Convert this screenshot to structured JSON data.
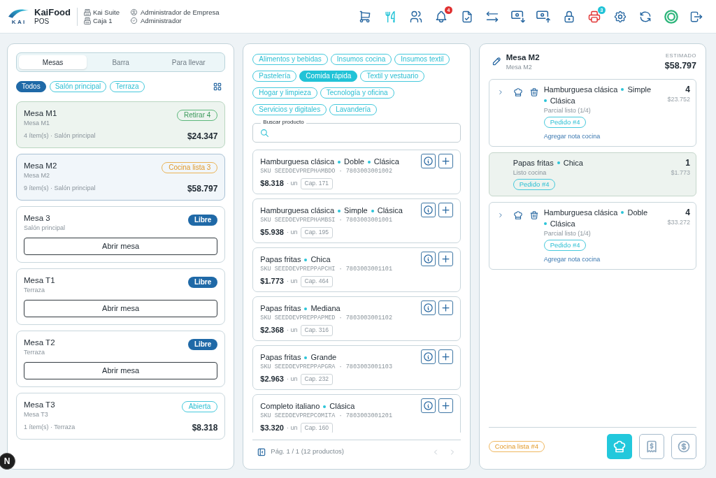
{
  "header": {
    "logo_text": "KAI",
    "app_name": "KaiFood",
    "app_subtitle": "POS",
    "suite": "Kai Suite",
    "register": "Caja 1",
    "company_role": "Administrador de Empresa",
    "user_role": "Administrador",
    "actions": [
      {
        "kind": "cart",
        "color": "#2767a1"
      },
      {
        "kind": "menu",
        "color": "#22c3d7"
      },
      {
        "kind": "customers",
        "color": "#2767a1"
      },
      {
        "kind": "notifications",
        "color": "#2767a1",
        "badge": {
          "text": "4",
          "color": "#e03131"
        }
      },
      {
        "kind": "documents",
        "color": "#2767a1"
      },
      {
        "kind": "transfer",
        "color": "#2767a1"
      },
      {
        "kind": "cash_in",
        "color": "#2767a1"
      },
      {
        "kind": "cash_out",
        "color": "#2767a1"
      },
      {
        "kind": "lock",
        "color": "#2767a1"
      },
      {
        "kind": "printer",
        "color": "#e03131",
        "badge": {
          "text": "3",
          "color": "#22c3d7"
        }
      },
      {
        "kind": "settings",
        "color": "#2767a1"
      },
      {
        "kind": "sync",
        "color": "#2767a1"
      },
      {
        "kind": "status",
        "color": "#2fb67c"
      },
      {
        "kind": "logout",
        "color": "#2767a1"
      }
    ]
  },
  "tables_panel": {
    "tabs": [
      {
        "label": "Mesas",
        "selected": true
      },
      {
        "label": "Barra",
        "selected": false
      },
      {
        "label": "Para llevar",
        "selected": false
      }
    ],
    "zones": [
      {
        "label": "Todos",
        "selected": true
      },
      {
        "label": "Salón principal",
        "selected": false
      },
      {
        "label": "Terraza",
        "selected": false
      }
    ],
    "tables": [
      {
        "kind": "occupied",
        "name": "Mesa M1",
        "subtitle": "Mesa M1",
        "selected": false,
        "status": {
          "kind": "pickup",
          "label": "Retirar 4"
        },
        "summary": "4 ítem(s) · Salón principal",
        "total": "$24.347"
      },
      {
        "kind": "occupied",
        "name": "Mesa M2",
        "subtitle": "Mesa M2",
        "selected": true,
        "status": {
          "kind": "kitchen",
          "label": "Cocina lista 3"
        },
        "summary": "9 ítem(s) · Salón principal",
        "total": "$58.797"
      },
      {
        "kind": "free",
        "name": "Mesa 3",
        "subtitle": "Salón principal",
        "selected": false,
        "status": {
          "kind": "free",
          "label": "Libre"
        },
        "action": "Abrir mesa"
      },
      {
        "kind": "free",
        "name": "Mesa T1",
        "subtitle": "Terraza",
        "selected": false,
        "status": {
          "kind": "free",
          "label": "Libre"
        },
        "action": "Abrir mesa"
      },
      {
        "kind": "free",
        "name": "Mesa T2",
        "subtitle": "Terraza",
        "selected": false,
        "status": {
          "kind": "free",
          "label": "Libre"
        },
        "action": "Abrir mesa"
      },
      {
        "kind": "occupied",
        "name": "Mesa T3",
        "subtitle": "Mesa T3",
        "selected": false,
        "status": {
          "kind": "open",
          "label": "Abierta"
        },
        "summary": "1 ítem(s) · Terraza",
        "total": "$8.318"
      }
    ]
  },
  "products_panel": {
    "categories": [
      {
        "label": "Alimentos y bebidas",
        "selected": false
      },
      {
        "label": "Insumos cocina",
        "selected": false
      },
      {
        "label": "Insumos textil",
        "selected": false
      },
      {
        "label": "Pastelería",
        "selected": false
      },
      {
        "label": "Comida rápida",
        "selected": true
      },
      {
        "label": "Textil y vestuario",
        "selected": false
      },
      {
        "label": "Hogar y limpieza",
        "selected": false
      },
      {
        "label": "Tecnología y oficina",
        "selected": false
      },
      {
        "label": "Servicios y digitales",
        "selected": false
      },
      {
        "label": "Lavandería",
        "selected": false
      }
    ],
    "search": {
      "label": "Buscar producto"
    },
    "products": [
      {
        "name_parts": [
          "Hamburguesa clásica",
          "Doble",
          "Clásica"
        ],
        "sku": "SKU SEEDDEVPREPHAMBDO · 7803003001002",
        "price": "$8.318",
        "unit": "· un",
        "stock": "Cap. 171"
      },
      {
        "name_parts": [
          "Hamburguesa clásica",
          "Simple",
          "Clásica"
        ],
        "sku": "SKU SEEDDEVPREPHAMBSI · 7803003001001",
        "price": "$5.938",
        "unit": "· un",
        "stock": "Cap. 195"
      },
      {
        "name_parts": [
          "Papas fritas",
          "Chica"
        ],
        "sku": "SKU SEEDDEVPREPPAPCHI · 7803003001101",
        "price": "$1.773",
        "unit": "· un",
        "stock": "Cap. 464"
      },
      {
        "name_parts": [
          "Papas fritas",
          "Mediana"
        ],
        "sku": "SKU SEEDDEVPREPPAPMED · 7803003001102",
        "price": "$2.368",
        "unit": "· un",
        "stock": "Cap. 316"
      },
      {
        "name_parts": [
          "Papas fritas",
          "Grande"
        ],
        "sku": "SKU SEEDDEVPREPPAPGRA · 7803003001103",
        "price": "$2.963",
        "unit": "· un",
        "stock": "Cap. 232"
      },
      {
        "name_parts": [
          "Completo italiano",
          "Clásica"
        ],
        "sku": "SKU SEEDDEVPREPCOMITA · 7803003001201",
        "price": "$3.320",
        "unit": "· un",
        "stock": "Cap. 160"
      }
    ],
    "pagination": {
      "label": "Pág. 1 / 1 (12 productos)",
      "prev": {
        "disabled": true
      },
      "next": {
        "disabled": true
      }
    }
  },
  "order_panel": {
    "title": "Mesa M2",
    "subtitle": "Mesa M2",
    "total_label": "ESTIMADO",
    "total": "$58.797",
    "items": [
      {
        "kind": "pending",
        "name_parts": [
          "Hamburguesa clásica",
          "Simple",
          "Clásica"
        ],
        "qty": "4",
        "price": "$23.752",
        "status": "Parcial listo (1/4)",
        "order": "Pedido #4",
        "note_link": "Agregar nota cocina"
      },
      {
        "kind": "ready",
        "name_parts": [
          "Papas fritas",
          "Chica"
        ],
        "qty": "1",
        "price": "$1.773",
        "status": "Listo cocina",
        "order": "Pedido #4"
      },
      {
        "kind": "pending",
        "name_parts": [
          "Hamburguesa clásica",
          "Doble",
          "Clásica"
        ],
        "qty": "4",
        "price": "$33.272",
        "status": "Parcial listo (1/4)",
        "order": "Pedido #4",
        "note_link": "Agregar nota cocina"
      }
    ],
    "footer": {
      "status": "Cocina lista #4",
      "actions": [
        {
          "kind": "kitchen",
          "selected": true
        },
        {
          "kind": "receipt",
          "selected": false
        },
        {
          "kind": "pay",
          "selected": false
        }
      ]
    }
  },
  "dev_badge": "N"
}
